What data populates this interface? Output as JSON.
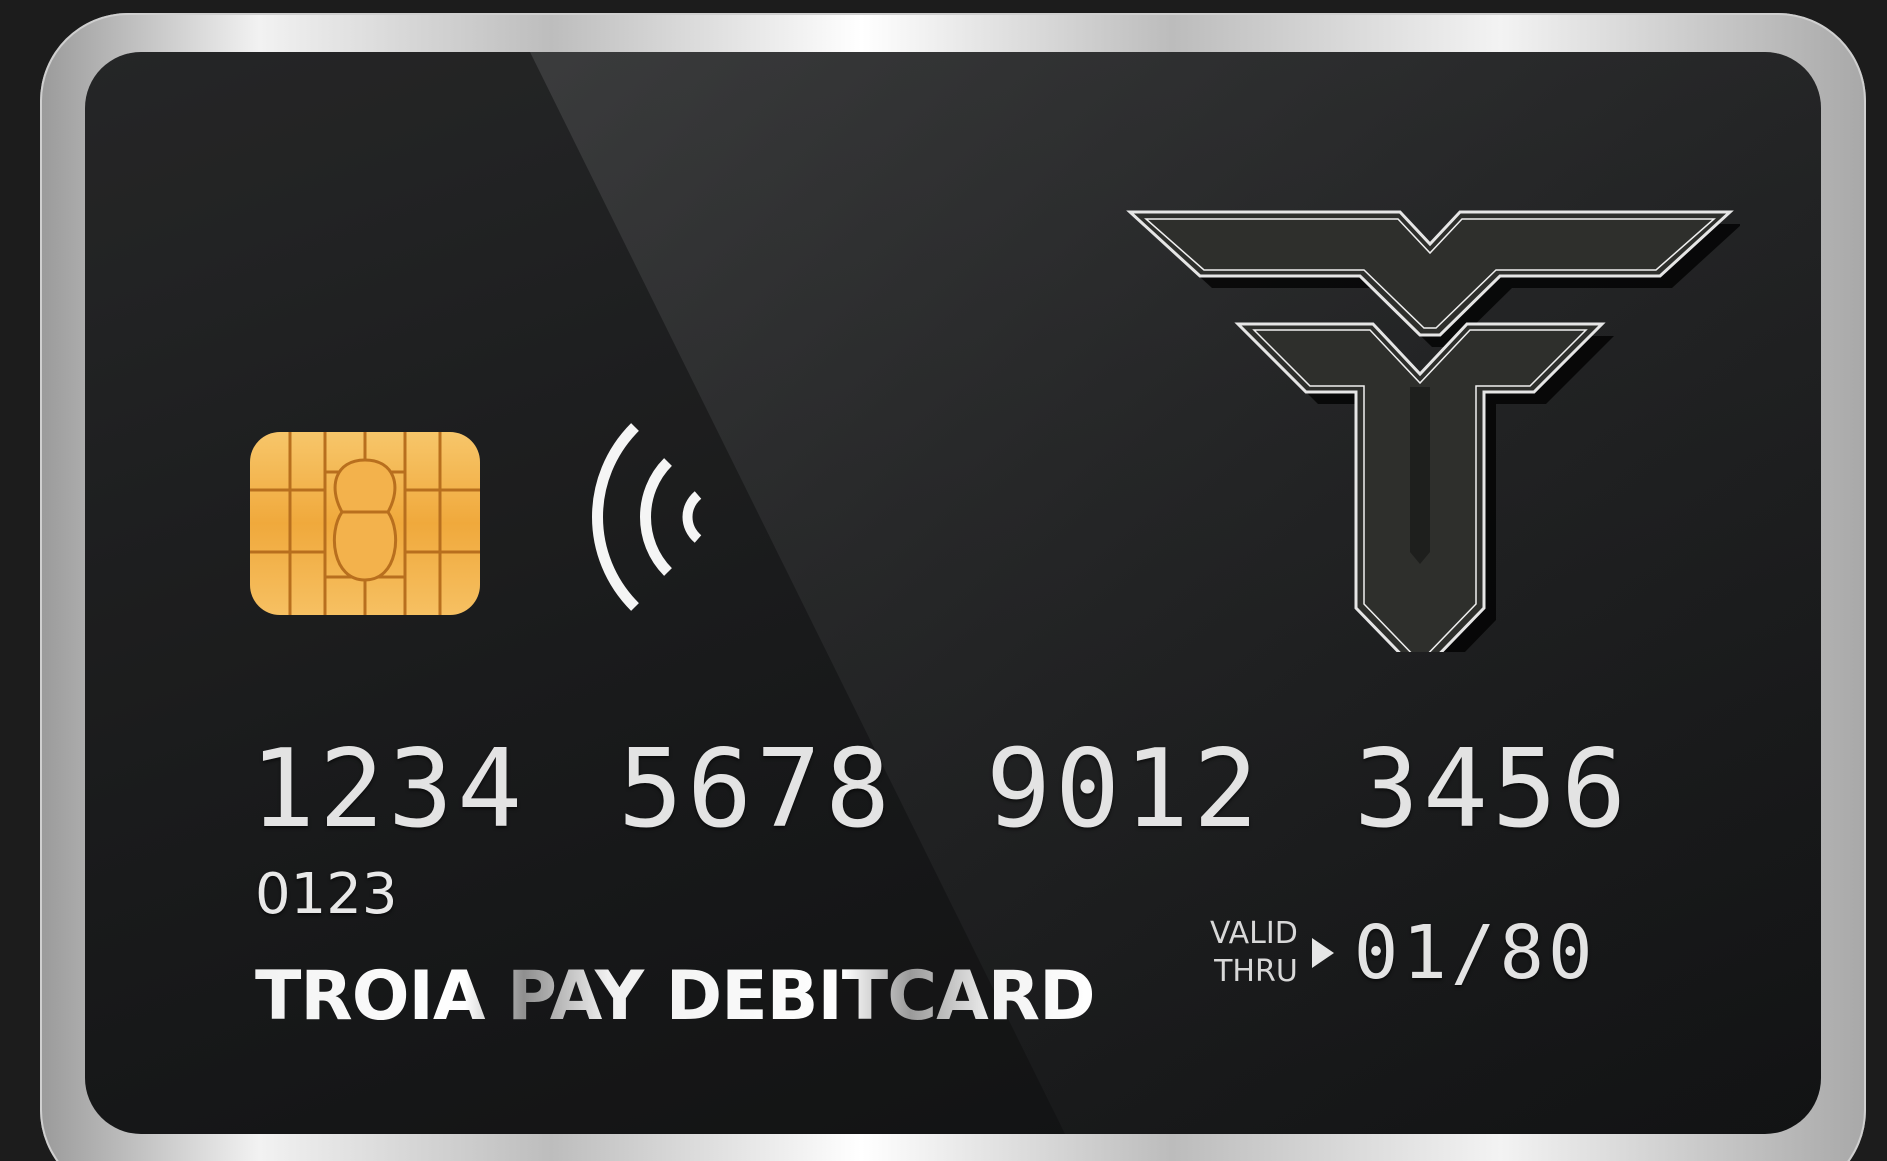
{
  "card": {
    "number_groups": [
      "1234",
      "5678",
      "9012",
      "3456"
    ],
    "code": "0123",
    "brand": "TROIA PAY DEBITCARD",
    "valid_label_line1": "VALID",
    "valid_label_line2": "THRU",
    "valid_date": "01/80"
  },
  "icons": {
    "chip": "emv-chip-icon",
    "contactless": "contactless-icon",
    "logo": "troia-logo"
  },
  "colors": {
    "card_face": "#1e1f20",
    "frame_silver": "#d9d9d9",
    "chip_gold": "#f2b24a",
    "text": "#e3e3e3"
  }
}
